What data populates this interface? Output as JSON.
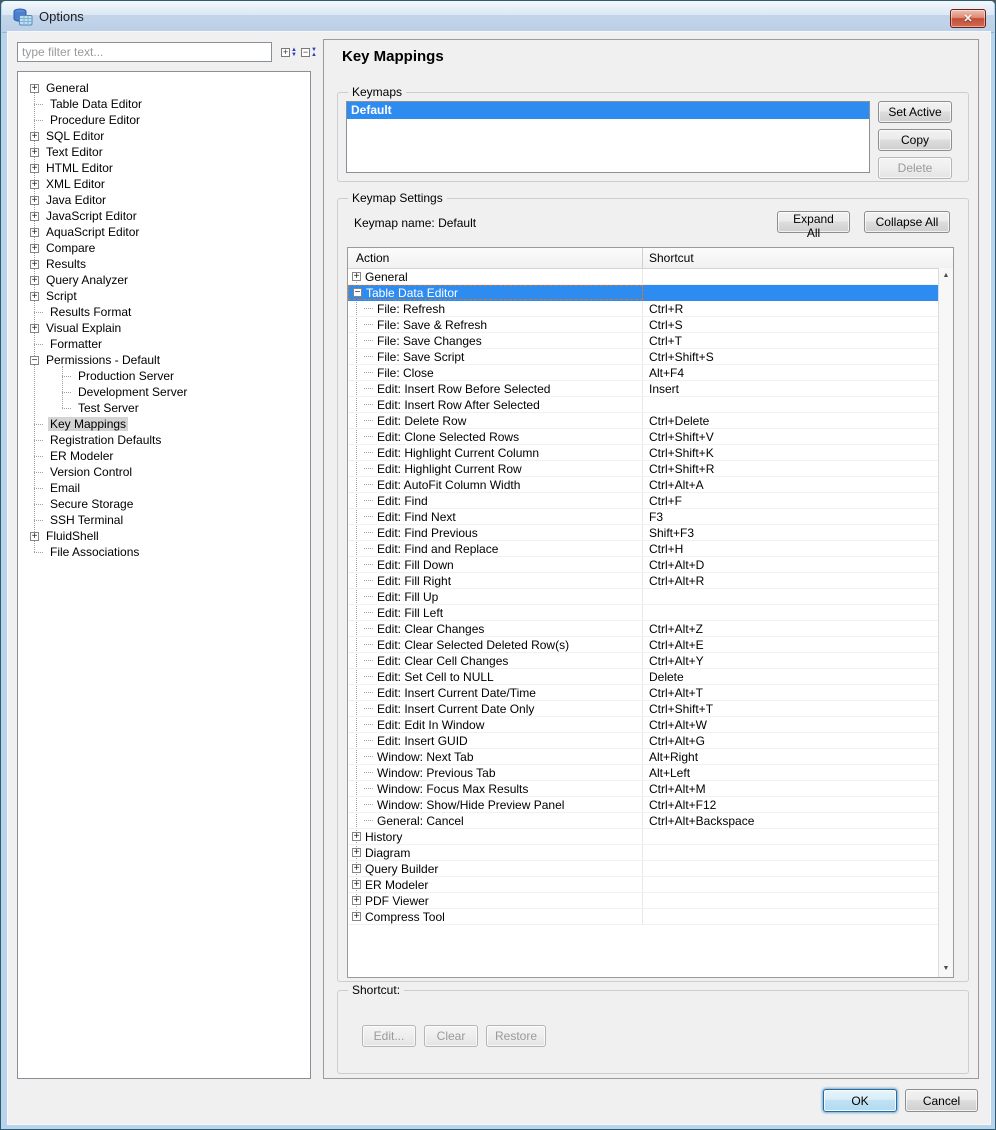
{
  "window": {
    "title": "Options"
  },
  "icons": {
    "close": "✕",
    "scroll_up": "▲",
    "scroll_down": "▼",
    "expander_plus": "+",
    "expander_minus": "−",
    "tree_expand_all": "+",
    "tree_collapse_all": "−"
  },
  "colors": {
    "selection_blue": "#2e8cf0",
    "focus_orange": "#c87a3a",
    "frame_blue": "#b9d4ea",
    "close_red": "#c14f38",
    "tree_selected_gray": "#d4d4d4"
  },
  "sidebar": {
    "filter_placeholder": "type filter text...",
    "tree": [
      {
        "label": "General",
        "level": 0,
        "expander": "plus",
        "selected": false
      },
      {
        "label": "Table Data Editor",
        "level": 0,
        "expander": null,
        "selected": false
      },
      {
        "label": "Procedure Editor",
        "level": 0,
        "expander": null,
        "selected": false
      },
      {
        "label": "SQL Editor",
        "level": 0,
        "expander": "plus",
        "selected": false
      },
      {
        "label": "Text Editor",
        "level": 0,
        "expander": "plus",
        "selected": false
      },
      {
        "label": "HTML Editor",
        "level": 0,
        "expander": "plus",
        "selected": false
      },
      {
        "label": "XML Editor",
        "level": 0,
        "expander": "plus",
        "selected": false
      },
      {
        "label": "Java Editor",
        "level": 0,
        "expander": "plus",
        "selected": false
      },
      {
        "label": "JavaScript Editor",
        "level": 0,
        "expander": "plus",
        "selected": false
      },
      {
        "label": "AquaScript Editor",
        "level": 0,
        "expander": "plus",
        "selected": false
      },
      {
        "label": "Compare",
        "level": 0,
        "expander": "plus",
        "selected": false
      },
      {
        "label": "Results",
        "level": 0,
        "expander": "plus",
        "selected": false
      },
      {
        "label": "Query Analyzer",
        "level": 0,
        "expander": "plus",
        "selected": false
      },
      {
        "label": "Script",
        "level": 0,
        "expander": "plus",
        "selected": false
      },
      {
        "label": "Results Format",
        "level": 0,
        "expander": null,
        "selected": false
      },
      {
        "label": "Visual Explain",
        "level": 0,
        "expander": "plus",
        "selected": false
      },
      {
        "label": "Formatter",
        "level": 0,
        "expander": null,
        "selected": false
      },
      {
        "label": "Permissions - Default",
        "level": 0,
        "expander": "minus",
        "selected": false
      },
      {
        "label": "Production Server",
        "level": 1,
        "expander": null,
        "selected": false
      },
      {
        "label": "Development Server",
        "level": 1,
        "expander": null,
        "selected": false
      },
      {
        "label": "Test Server",
        "level": 1,
        "expander": null,
        "selected": false
      },
      {
        "label": "Key Mappings",
        "level": 0,
        "expander": null,
        "selected": true
      },
      {
        "label": "Registration Defaults",
        "level": 0,
        "expander": null,
        "selected": false
      },
      {
        "label": "ER Modeler",
        "level": 0,
        "expander": null,
        "selected": false
      },
      {
        "label": "Version Control",
        "level": 0,
        "expander": null,
        "selected": false
      },
      {
        "label": "Email",
        "level": 0,
        "expander": null,
        "selected": false
      },
      {
        "label": "Secure Storage",
        "level": 0,
        "expander": null,
        "selected": false
      },
      {
        "label": "SSH Terminal",
        "level": 0,
        "expander": null,
        "selected": false
      },
      {
        "label": "FluidShell",
        "level": 0,
        "expander": "plus",
        "selected": false
      },
      {
        "label": "File Associations",
        "level": 0,
        "expander": null,
        "selected": false
      }
    ]
  },
  "main": {
    "title": "Key Mappings",
    "keymaps_group": {
      "legend": "Keymaps",
      "items": [
        {
          "label": "Default",
          "selected": true
        }
      ],
      "buttons": [
        {
          "label": "Set Active",
          "enabled": true
        },
        {
          "label": "Copy",
          "enabled": true
        },
        {
          "label": "Delete",
          "enabled": false
        }
      ]
    },
    "settings_group": {
      "legend": "Keymap Settings",
      "keymap_name_label": "Keymap name:",
      "keymap_name_value": "Default",
      "expand_all": "Expand All",
      "collapse_all": "Collapse All",
      "table": {
        "columns": [
          "Action",
          "Shortcut"
        ],
        "rows": [
          {
            "action": "General",
            "shortcut": "",
            "type": "group",
            "expander": "plus",
            "selected": false
          },
          {
            "action": "Table Data Editor",
            "shortcut": "",
            "type": "group",
            "expander": "minus",
            "selected": true
          },
          {
            "action": "File: Refresh",
            "shortcut": "Ctrl+R",
            "type": "item"
          },
          {
            "action": "File: Save & Refresh",
            "shortcut": "Ctrl+S",
            "type": "item"
          },
          {
            "action": "File: Save Changes",
            "shortcut": "Ctrl+T",
            "type": "item"
          },
          {
            "action": "File: Save Script",
            "shortcut": "Ctrl+Shift+S",
            "type": "item"
          },
          {
            "action": "File: Close",
            "shortcut": "Alt+F4",
            "type": "item"
          },
          {
            "action": "Edit: Insert Row Before Selected",
            "shortcut": "Insert",
            "type": "item"
          },
          {
            "action": "Edit: Insert Row After Selected",
            "shortcut": "",
            "type": "item"
          },
          {
            "action": "Edit: Delete Row",
            "shortcut": "Ctrl+Delete",
            "type": "item"
          },
          {
            "action": "Edit: Clone Selected Rows",
            "shortcut": "Ctrl+Shift+V",
            "type": "item"
          },
          {
            "action": "Edit: Highlight Current Column",
            "shortcut": "Ctrl+Shift+K",
            "type": "item"
          },
          {
            "action": "Edit: Highlight Current Row",
            "shortcut": "Ctrl+Shift+R",
            "type": "item"
          },
          {
            "action": "Edit: AutoFit Column Width",
            "shortcut": "Ctrl+Alt+A",
            "type": "item"
          },
          {
            "action": "Edit: Find",
            "shortcut": "Ctrl+F",
            "type": "item"
          },
          {
            "action": "Edit: Find Next",
            "shortcut": "F3",
            "type": "item"
          },
          {
            "action": "Edit: Find Previous",
            "shortcut": "Shift+F3",
            "type": "item"
          },
          {
            "action": "Edit: Find and Replace",
            "shortcut": "Ctrl+H",
            "type": "item"
          },
          {
            "action": "Edit: Fill Down",
            "shortcut": "Ctrl+Alt+D",
            "type": "item"
          },
          {
            "action": "Edit: Fill Right",
            "shortcut": "Ctrl+Alt+R",
            "type": "item"
          },
          {
            "action": "Edit: Fill Up",
            "shortcut": "",
            "type": "item"
          },
          {
            "action": "Edit: Fill Left",
            "shortcut": "",
            "type": "item"
          },
          {
            "action": "Edit: Clear Changes",
            "shortcut": "Ctrl+Alt+Z",
            "type": "item"
          },
          {
            "action": "Edit: Clear Selected Deleted Row(s)",
            "shortcut": "Ctrl+Alt+E",
            "type": "item"
          },
          {
            "action": "Edit: Clear Cell Changes",
            "shortcut": "Ctrl+Alt+Y",
            "type": "item"
          },
          {
            "action": "Edit: Set Cell to NULL",
            "shortcut": "Delete",
            "type": "item"
          },
          {
            "action": "Edit: Insert Current Date/Time",
            "shortcut": "Ctrl+Alt+T",
            "type": "item"
          },
          {
            "action": "Edit: Insert Current Date Only",
            "shortcut": "Ctrl+Shift+T",
            "type": "item"
          },
          {
            "action": "Edit: Edit In Window",
            "shortcut": "Ctrl+Alt+W",
            "type": "item"
          },
          {
            "action": "Edit: Insert GUID",
            "shortcut": "Ctrl+Alt+G",
            "type": "item"
          },
          {
            "action": "Window: Next Tab",
            "shortcut": "Alt+Right",
            "type": "item"
          },
          {
            "action": "Window: Previous Tab",
            "shortcut": "Alt+Left",
            "type": "item"
          },
          {
            "action": "Window: Focus Max Results",
            "shortcut": "Ctrl+Alt+M",
            "type": "item"
          },
          {
            "action": "Window: Show/Hide Preview Panel",
            "shortcut": "Ctrl+Alt+F12",
            "type": "item"
          },
          {
            "action": "General: Cancel",
            "shortcut": "Ctrl+Alt+Backspace",
            "type": "item"
          },
          {
            "action": "History",
            "shortcut": "",
            "type": "group",
            "expander": "plus",
            "selected": false
          },
          {
            "action": "Diagram",
            "shortcut": "",
            "type": "group",
            "expander": "plus",
            "selected": false
          },
          {
            "action": "Query Builder",
            "shortcut": "",
            "type": "group",
            "expander": "plus",
            "selected": false
          },
          {
            "action": "ER Modeler",
            "shortcut": "",
            "type": "group",
            "expander": "plus",
            "selected": false
          },
          {
            "action": "PDF Viewer",
            "shortcut": "",
            "type": "group",
            "expander": "plus",
            "selected": false
          },
          {
            "action": "Compress Tool",
            "shortcut": "",
            "type": "group",
            "expander": "plus",
            "selected": false
          }
        ]
      }
    },
    "shortcut_group": {
      "legend": "Shortcut:",
      "buttons": [
        {
          "label": "Edit...",
          "enabled": false
        },
        {
          "label": "Clear",
          "enabled": false
        },
        {
          "label": "Restore",
          "enabled": false
        }
      ]
    },
    "footer": {
      "ok": "OK",
      "cancel": "Cancel"
    }
  }
}
